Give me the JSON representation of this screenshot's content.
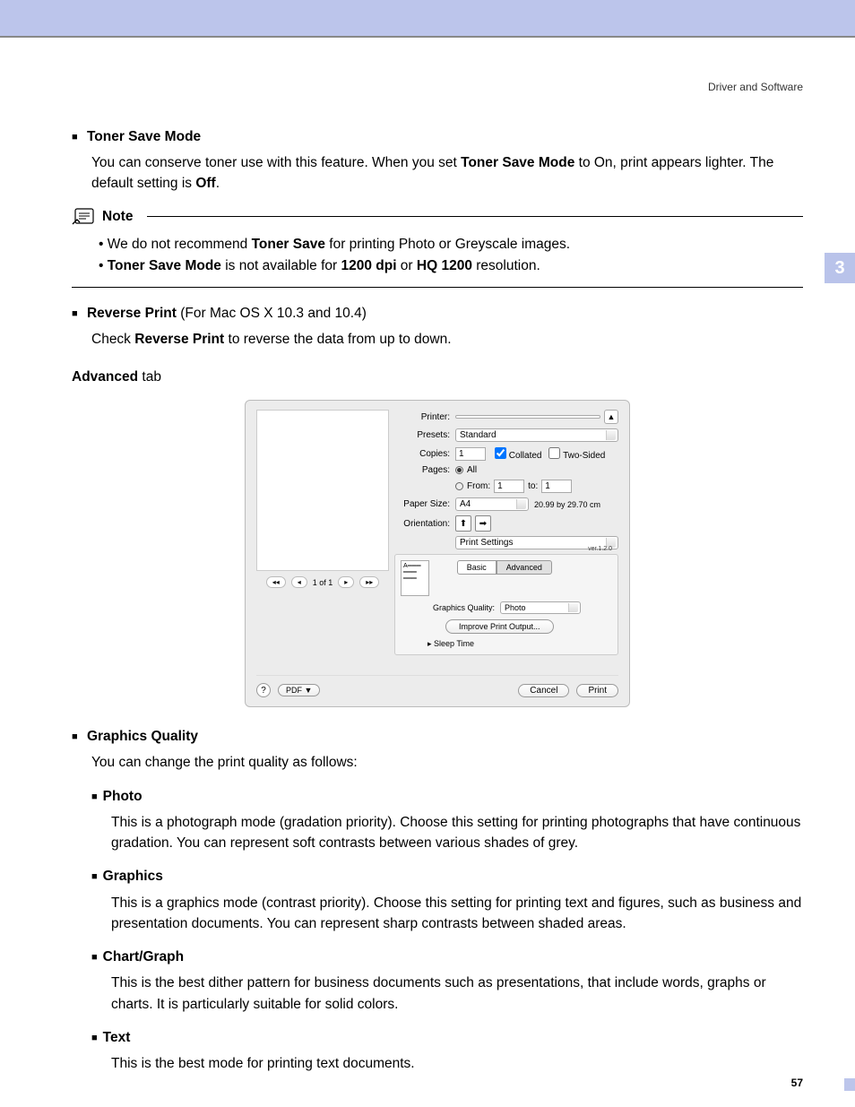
{
  "header": {
    "section": "Driver and Software"
  },
  "chapterTab": "3",
  "pageNumber": "57",
  "tonerSave": {
    "title": "Toner Save Mode",
    "body_pre": "You can conserve toner use with this feature. When you set ",
    "body_bold1": "Toner Save Mode",
    "body_mid": " to On, print appears lighter. The default setting is ",
    "body_bold2": "Off",
    "body_end": "."
  },
  "note": {
    "label": "Note",
    "b1_pre": "We do not recommend ",
    "b1_bold": "Toner Save",
    "b1_post": " for printing Photo or Greyscale images.",
    "b2_bold1": "Toner Save Mode",
    "b2_mid": " is not available for ",
    "b2_bold2": "1200 dpi",
    "b2_or": " or ",
    "b2_bold3": "HQ 1200",
    "b2_post": " resolution."
  },
  "reverse": {
    "title": "Reverse Print",
    "suffix": " (For Mac OS X 10.3 and 10.4)",
    "body_pre": "Check ",
    "body_bold": "Reverse Print",
    "body_post": " to reverse the data from up to down."
  },
  "advancedTab": {
    "title_bold": "Advanced",
    "title_rest": " tab"
  },
  "dialog": {
    "printer": {
      "label": "Printer:",
      "value": ""
    },
    "presets": {
      "label": "Presets:",
      "value": "Standard"
    },
    "copies": {
      "label": "Copies:",
      "value": "1",
      "collated": "Collated",
      "twosided": "Two-Sided"
    },
    "pages": {
      "label": "Pages:",
      "all": "All",
      "fromLabel": "From:",
      "from": "1",
      "toLabel": "to:",
      "to": "1"
    },
    "paperSize": {
      "label": "Paper Size:",
      "value": "A4",
      "dim": "20.99 by 29.70 cm"
    },
    "orientation": {
      "label": "Orientation:"
    },
    "panelDropdown": "Print Settings",
    "version": "ver.1.2.0",
    "tabs": {
      "basic": "Basic",
      "advanced": "Advanced"
    },
    "graphicsQuality": {
      "label": "Graphics Quality:",
      "value": "Photo"
    },
    "improveBtn": "Improve Print Output...",
    "sleep": "Sleep Time",
    "nav": "1 of 1",
    "pdfBtn": "PDF ▼",
    "help": "?",
    "cancel": "Cancel",
    "print": "Print",
    "expand": "▲"
  },
  "graphicsQuality": {
    "title": "Graphics Quality",
    "intro": "You can change the print quality as follows:",
    "photo": {
      "title": "Photo",
      "desc": "This is a photograph mode (gradation priority). Choose this setting for printing photographs that have continuous gradation. You can represent soft contrasts between various shades of grey."
    },
    "graphics": {
      "title": "Graphics",
      "desc": "This is a graphics mode (contrast priority). Choose this setting for printing text and figures, such as business and presentation documents. You can represent sharp contrasts between shaded areas."
    },
    "chart": {
      "title": "Chart/Graph",
      "desc": "This is the best dither pattern for business documents such as presentations, that include words, graphs or charts. It is particularly suitable for solid colors."
    },
    "text": {
      "title": "Text",
      "desc": "This is the best mode for printing text documents."
    }
  }
}
